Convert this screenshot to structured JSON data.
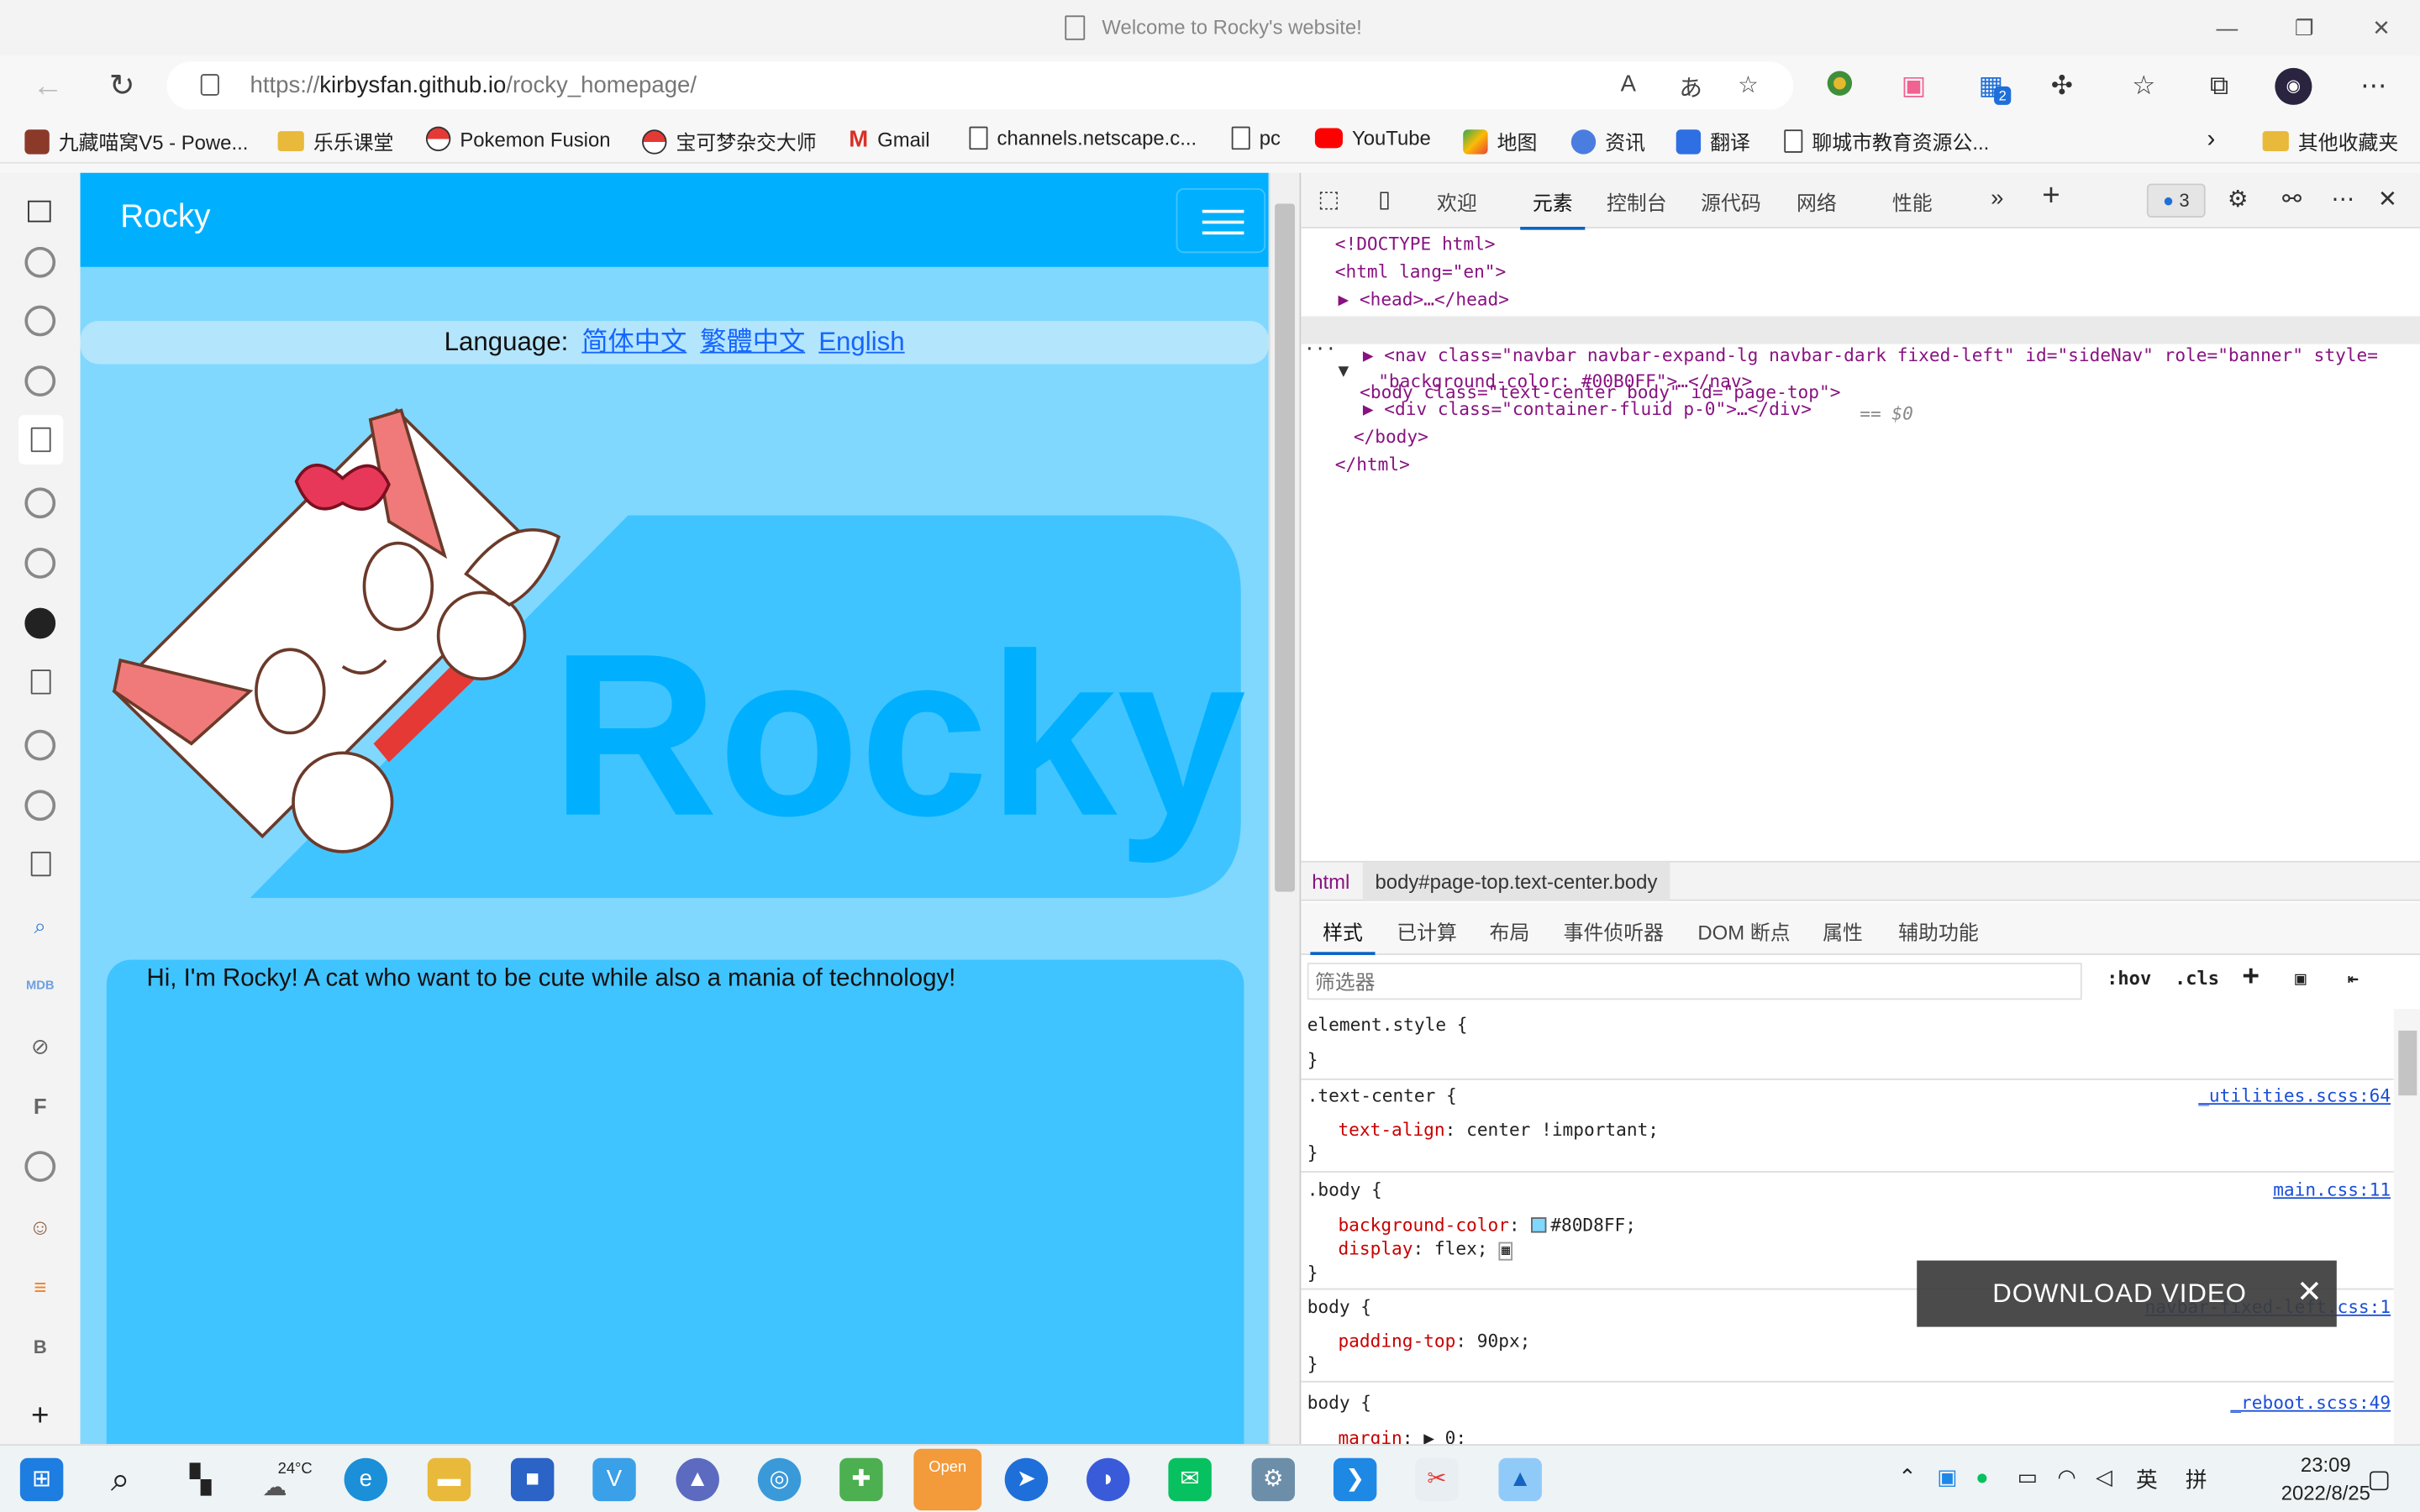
{
  "window": {
    "title": "Welcome to Rocky's website!"
  },
  "address": {
    "url_prefix": "https://",
    "url_host": "kirbysfan.github.io",
    "url_path": "/rocky_homepage/"
  },
  "toolbar_badges": {
    "collections_count": "2"
  },
  "favorites": [
    {
      "label": "九藏喵窝V5 - Powe...",
      "icon": "site-icon"
    },
    {
      "label": "乐乐课堂",
      "icon": "folder-icon"
    },
    {
      "label": "Pokemon Fusion",
      "icon": "pokeball-icon"
    },
    {
      "label": "宝可梦杂交大师",
      "icon": "pokeball-icon"
    },
    {
      "label": "Gmail",
      "icon": "gmail-icon"
    },
    {
      "label": "channels.netscape.c...",
      "icon": "page-icon"
    },
    {
      "label": "pc",
      "icon": "page-icon"
    },
    {
      "label": "YouTube",
      "icon": "youtube-icon"
    },
    {
      "label": "地图",
      "icon": "maps-icon"
    },
    {
      "label": "资讯",
      "icon": "news-icon"
    },
    {
      "label": "翻译",
      "icon": "translate-icon"
    },
    {
      "label": "聊城市教育资源公...",
      "icon": "page-icon"
    }
  ],
  "other_favorites": "其他收藏夹",
  "page": {
    "brand": "Rocky",
    "language_label": "Language:",
    "languages": [
      "简体中文",
      "繁體中文",
      "English"
    ],
    "logo_text": "Rocky",
    "intro": "Hi, I'm Rocky! A cat who want to be cute while also a mania of technology!",
    "colors": {
      "navbar": "#00B0FF",
      "body": "#80D8FF",
      "card": "#40C4FF"
    }
  },
  "devtools": {
    "tabs": [
      "欢迎",
      "元素",
      "控制台",
      "源代码",
      "网络",
      "性能"
    ],
    "active_tab": "元素",
    "issues_count": "3",
    "dom": {
      "doctype": "<!DOCTYPE html>",
      "html_open": "<html lang=\"en\">",
      "head": "<head>…</head>",
      "body_tag": "<body class=\"text-center body\" id=\"page-top\">",
      "body_marker": "== $0",
      "nav_line1": "<nav class=\"navbar navbar-expand-lg navbar-dark fixed-left\" id=\"sideNav\" role=\"banner\" style=",
      "nav_line2": "\"background-color: #00B0FF\">…</nav>",
      "div_line": "<div class=\"container-fluid p-0\">…</div>",
      "body_close": "</body>",
      "html_close": "</html>"
    },
    "breadcrumb": [
      "html",
      "body#page-top.text-center.body"
    ],
    "style_tabs": [
      "样式",
      "已计算",
      "布局",
      "事件侦听器",
      "DOM 断点",
      "属性",
      "辅助功能"
    ],
    "filter_placeholder": "筛选器",
    "filter_tools": [
      ":hov",
      ".cls"
    ],
    "rules": {
      "r1_selector": "element.style {",
      "r2_selector": ".text-center {",
      "r2_source": "_utilities.scss:64",
      "r2_prop": "text-align",
      "r2_val": "center !important;",
      "r3_selector": ".body {",
      "r3_source": "main.css:11",
      "r3_prop1": "background-color",
      "r3_val1": "#80D8FF;",
      "r3_prop2": "display",
      "r3_val2": "flex;",
      "r4_selector": "body {",
      "r4_source": "navbar-fixed-left.css:1",
      "r4_prop": "padding-top",
      "r4_val": "90px;",
      "r5_selector": "body {",
      "r5_source": "_reboot.scss:49",
      "r5_prop": "margin",
      "r5_val": "0;",
      "close": "}"
    }
  },
  "overlay": {
    "download_video": "DOWNLOAD VIDEO"
  },
  "taskbar": {
    "weather": "24°C",
    "ime_lang": "英",
    "ime_mode": "拼",
    "time": "23:09",
    "date": "2022/8/25",
    "pinned": [
      "edge-icon",
      "file-explorer-icon",
      "store-icon",
      "app-icon",
      "app-icon",
      "app-icon",
      "app-icon",
      "openroot-icon",
      "app-icon",
      "app-icon",
      "wechat-icon",
      "settings-icon",
      "vscode-icon",
      "snip-icon",
      "photos-icon"
    ]
  }
}
